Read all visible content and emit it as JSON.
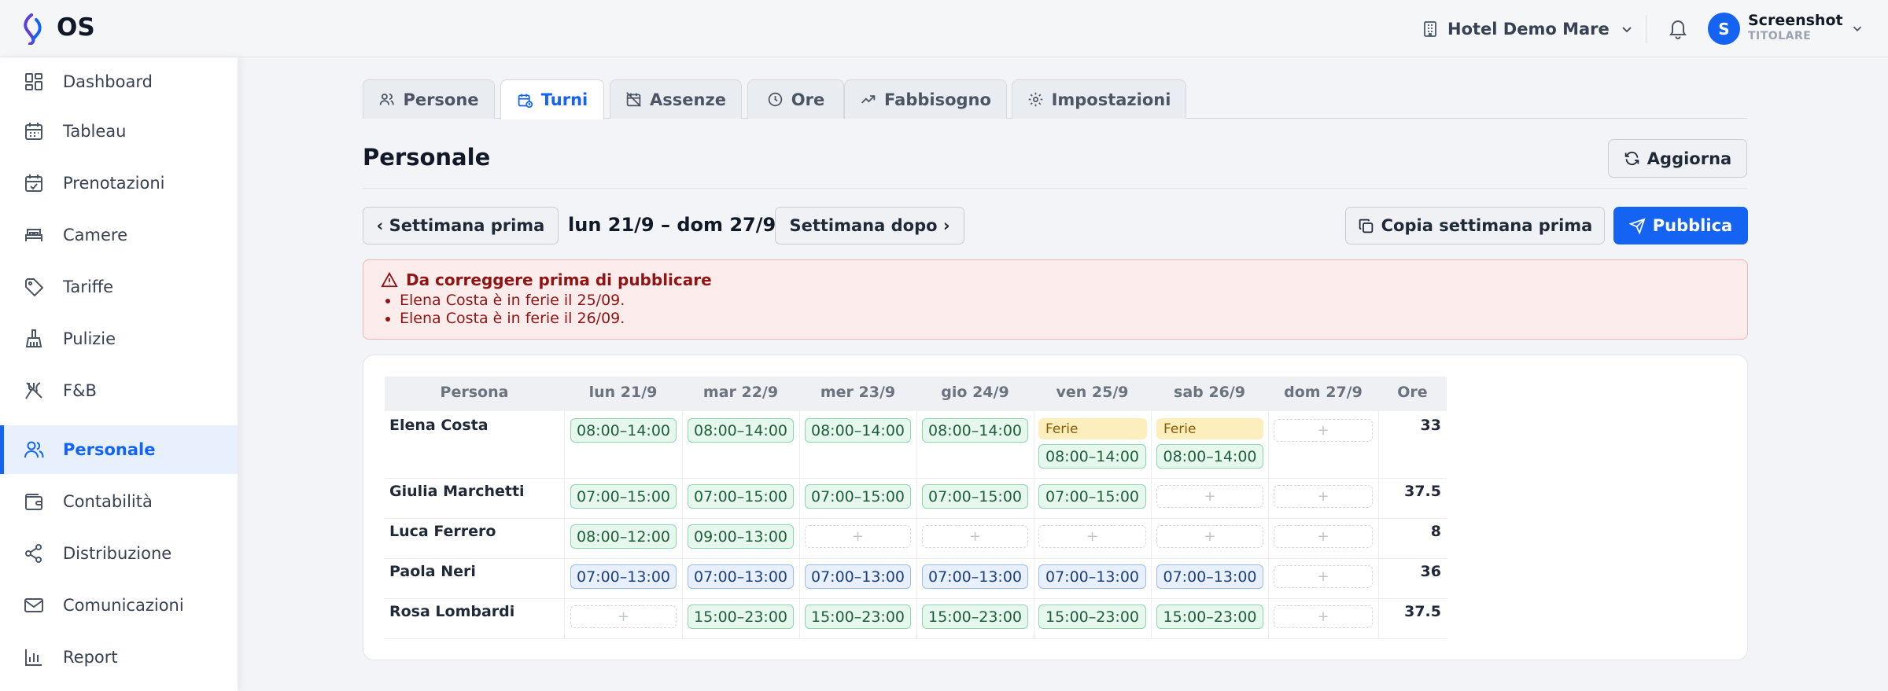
{
  "app": {
    "name": "OS"
  },
  "topbar": {
    "hotel": "Hotel Demo Mare",
    "user": {
      "initial": "S",
      "name": "Screenshot",
      "role": "TITOLARE"
    },
    "accent": "#1463f3"
  },
  "sidebar": {
    "items": [
      {
        "label": "Dashboard",
        "icon": "dashboard-icon"
      },
      {
        "label": "Tableau",
        "icon": "calendar-icon"
      },
      {
        "label": "Prenotazioni",
        "icon": "calendar-check-icon"
      },
      {
        "label": "Camere",
        "icon": "bed-icon"
      },
      {
        "label": "Tariffe",
        "icon": "tag-icon"
      },
      {
        "label": "Pulizie",
        "icon": "brush-icon"
      },
      {
        "label": "F&B",
        "icon": "utensils-icon"
      },
      {
        "label": "Personale",
        "icon": "users-icon",
        "active": true
      },
      {
        "label": "Contabilità",
        "icon": "wallet-icon"
      },
      {
        "label": "Distribuzione",
        "icon": "share-icon"
      },
      {
        "label": "Comunicazioni",
        "icon": "mail-icon"
      },
      {
        "label": "Report",
        "icon": "bar-chart-icon"
      }
    ]
  },
  "tabs": [
    {
      "label": "Persone",
      "icon": "users-icon"
    },
    {
      "label": "Turni",
      "icon": "calendar-clock-icon",
      "active": true
    },
    {
      "label": "Assenze",
      "icon": "calendar-off-icon"
    },
    {
      "label": "Ore",
      "icon": "clock-icon"
    },
    {
      "label": "Fabbisogno",
      "icon": "trend-up-icon"
    },
    {
      "label": "Impostazioni",
      "icon": "gear-icon"
    }
  ],
  "page": {
    "title": "Personale",
    "refresh": "Aggiorna",
    "prev_week": "‹ Settimana prima",
    "week_range": "lun 21/9 – dom 27/9",
    "next_week": "Settimana dopo ›",
    "copy_week": "Copia settimana prima",
    "publish": "Pubblica"
  },
  "alert": {
    "title": "Da correggere prima di pubblicare",
    "items": [
      "Elena Costa è in ferie il 25/09.",
      "Elena Costa è in ferie il 26/09."
    ]
  },
  "schedule": {
    "headers": [
      "Persona",
      "lun 21/9",
      "mar 22/9",
      "mer 23/9",
      "gio 24/9",
      "ven 25/9",
      "sab 26/9",
      "dom 27/9",
      "Ore"
    ],
    "ferie_label": "Ferie",
    "add_symbol": "+",
    "rows": [
      {
        "name": "Elena Costa",
        "hours": "33",
        "shifts": [
          "08:00–14:00",
          "08:00–14:00",
          "08:00–14:00",
          "08:00–14:00",
          "08:00–14:00",
          "08:00–14:00",
          ""
        ],
        "ferie": [
          false,
          false,
          false,
          false,
          true,
          true,
          false
        ],
        "style": "green"
      },
      {
        "name": "Giulia Marchetti",
        "hours": "37.5",
        "shifts": [
          "07:00–15:00",
          "07:00–15:00",
          "07:00–15:00",
          "07:00–15:00",
          "07:00–15:00",
          "",
          ""
        ],
        "style": "green"
      },
      {
        "name": "Luca Ferrero",
        "hours": "8",
        "shifts": [
          "08:00–12:00",
          "09:00–13:00",
          "",
          "",
          "",
          "",
          ""
        ],
        "style": "green"
      },
      {
        "name": "Paola Neri",
        "hours": "36",
        "shifts": [
          "07:00–13:00",
          "07:00–13:00",
          "07:00–13:00",
          "07:00–13:00",
          "07:00–13:00",
          "07:00–13:00",
          ""
        ],
        "style": "blue"
      },
      {
        "name": "Rosa Lombardi",
        "hours": "37.5",
        "shifts": [
          "",
          "15:00–23:00",
          "15:00–23:00",
          "15:00–23:00",
          "15:00–23:00",
          "15:00–23:00",
          ""
        ],
        "style": "green"
      }
    ]
  }
}
